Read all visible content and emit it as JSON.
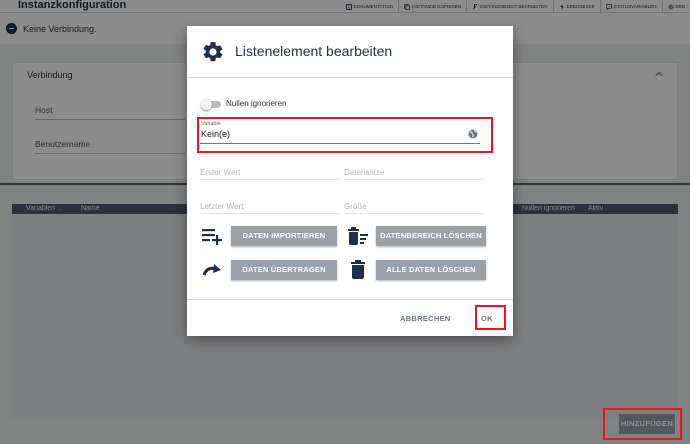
{
  "app": {
    "title": "Instanzkonfiguration"
  },
  "toolbar": {
    "items": [
      {
        "label": "DOKUMENTATION",
        "icon": "book-icon"
      },
      {
        "label": "INSTANZID KOPIEREN",
        "icon": "copy-icon"
      },
      {
        "label": "INSTANZOBJEKT BEARBEITEN",
        "icon": "wrench-icon"
      },
      {
        "label": "EREIGNISSE",
        "icon": "bolt-icon"
      },
      {
        "label": "STATUSVARIABLEN",
        "icon": "chat-icon"
      },
      {
        "label": "DEB",
        "icon": "gear-icon"
      }
    ]
  },
  "status": {
    "text": "Keine Verbindung."
  },
  "connection_panel": {
    "title": "Verbindung",
    "fields": [
      {
        "label": "Host"
      },
      {
        "label": "Benutzername"
      }
    ]
  },
  "list": {
    "columns": [
      "Variablen ...",
      "Name",
      "Nullen ignorieren",
      "Aktiv"
    ]
  },
  "add_button": {
    "label": "HINZUFÜGEN"
  },
  "dialog": {
    "title": "Listenelement bearbeiten",
    "toggle": {
      "label": "Nullen ignorieren",
      "checked": false
    },
    "variable": {
      "label": "Variable",
      "value": "Kein(e)"
    },
    "fields": {
      "erster_wert": "Erster Wert",
      "datensaetze": "Datensätze",
      "letzter_wert": "Letzter Wert",
      "groesse": "Größe"
    },
    "buttons": {
      "import": "DATEN IMPORTIEREN",
      "delete_range": "DATENBEREICH LÖSCHEN",
      "transfer": "DATEN ÜBERTRAGEN",
      "delete_all": "ALLE DATEN LÖSCHEN",
      "cancel": "ABBRECHEN",
      "ok": "OK"
    }
  },
  "colors": {
    "brand_dark": "#1e3148",
    "button_gray": "#9aa1a8",
    "highlight_red": "#e01b1b",
    "overlay": "rgba(0,0,0,0.45)"
  }
}
